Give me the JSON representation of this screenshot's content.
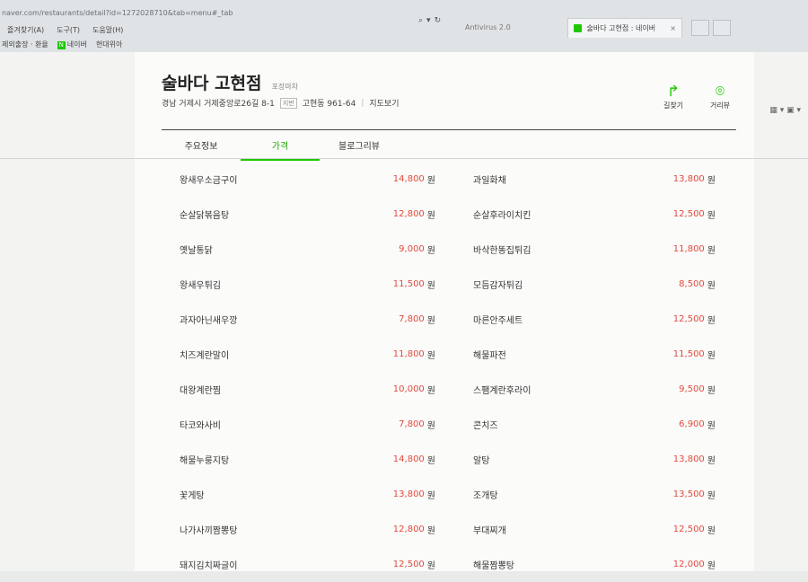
{
  "browser": {
    "url": "naver.com/restaurants/detail?id=1272028710&tab=menu#_tab",
    "tabs": [
      {
        "label": "Antivirus 2.0"
      },
      {
        "label": "술바다 고현점 : 네이버"
      }
    ],
    "menu": [
      "즐겨찾기(A)",
      "도구(T)",
      "도움말(H)"
    ],
    "favorites": [
      "제외출장 · 환율",
      "네이버",
      "현대위아"
    ],
    "tab_close": "×"
  },
  "place": {
    "name": "술바다 고현점",
    "category": "포장마차",
    "address": "경남 거제시 거제중앙로26길 8-1",
    "jibun_label": "지번",
    "jibun": "고현동 961-64",
    "map_link": "지도보기",
    "actions": [
      {
        "icon": "route-arrow-icon",
        "glyph": "↱",
        "label": "길찾기"
      },
      {
        "icon": "location-pin-icon",
        "glyph": "⌾",
        "label": "거리뷰"
      }
    ]
  },
  "tabs": [
    {
      "label": "주요정보"
    },
    {
      "label": "가격",
      "active": true
    },
    {
      "label": "블로그리뷰"
    }
  ],
  "currency": "원",
  "menu_rows": [
    [
      {
        "name": "왕새우소금구이",
        "price": "14,800"
      },
      {
        "name": "과일화채",
        "price": "13,800"
      }
    ],
    [
      {
        "name": "순살닭볶음탕",
        "price": "12,800"
      },
      {
        "name": "순살후라이치킨",
        "price": "12,500"
      }
    ],
    [
      {
        "name": "옛날통닭",
        "price": "9,000"
      },
      {
        "name": "바삭한똥집튀김",
        "price": "11,800"
      }
    ],
    [
      {
        "name": "왕새우튀김",
        "price": "11,500"
      },
      {
        "name": "모듬감자튀김",
        "price": "8,500"
      }
    ],
    [
      {
        "name": "과자아닌새우깡",
        "price": "7,800"
      },
      {
        "name": "마른안주세트",
        "price": "12,500"
      }
    ],
    [
      {
        "name": "치즈계란말이",
        "price": "11,800"
      },
      {
        "name": "해물파전",
        "price": "11,500"
      }
    ],
    [
      {
        "name": "대왕계란찜",
        "price": "10,000"
      },
      {
        "name": "스팸계란후라이",
        "price": "9,500"
      }
    ],
    [
      {
        "name": "타코와사비",
        "price": "7,800"
      },
      {
        "name": "콘치즈",
        "price": "6,900"
      }
    ],
    [
      {
        "name": "해물누룽지탕",
        "price": "14,800"
      },
      {
        "name": "알탕",
        "price": "13,800"
      }
    ],
    [
      {
        "name": "꽃게탕",
        "price": "13,800"
      },
      {
        "name": "조개탕",
        "price": "13,500"
      }
    ],
    [
      {
        "name": "나가사끼짬뽕탕",
        "price": "12,800"
      },
      {
        "name": "부대찌개",
        "price": "12,500"
      }
    ],
    [
      {
        "name": "돼지김치짜글이",
        "price": "12,500"
      },
      {
        "name": "해물짬뽕탕",
        "price": "12,000"
      }
    ]
  ],
  "colors": {
    "accent": "#1ec800",
    "price": "#e24b3e"
  }
}
